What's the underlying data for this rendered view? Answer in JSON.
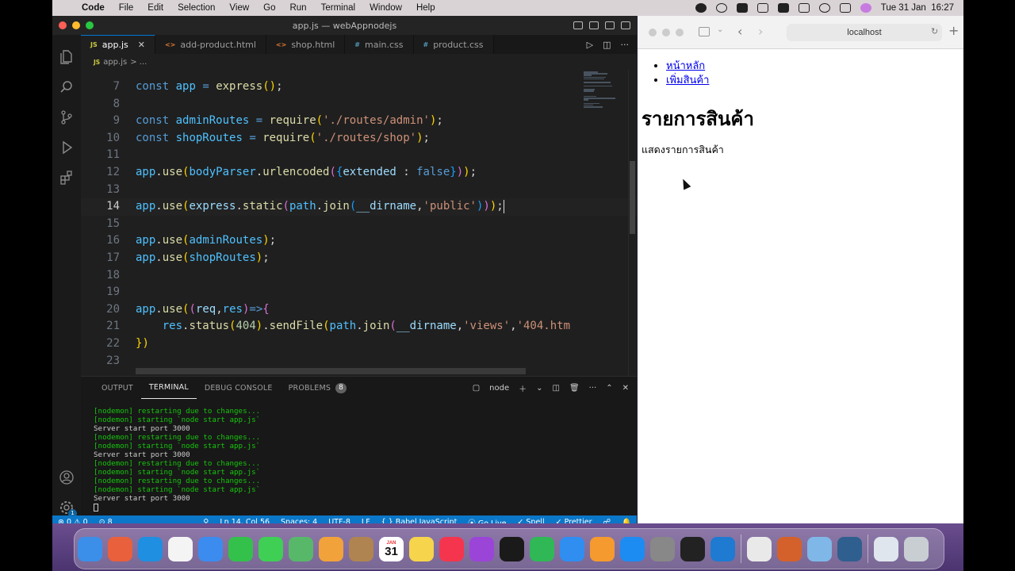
{
  "menubar": {
    "app": "Code",
    "items": [
      "File",
      "Edit",
      "Selection",
      "View",
      "Go",
      "Run",
      "Terminal",
      "Window",
      "Help"
    ],
    "clock": "Tue 31 Jan  16:27"
  },
  "vscode": {
    "title": "app.js — webAppnodejs",
    "tabs": [
      {
        "icon": "JS",
        "label": "app.js",
        "active": true
      },
      {
        "icon": "<>",
        "label": "add-product.html"
      },
      {
        "icon": "<>",
        "label": "shop.html"
      },
      {
        "icon": "#",
        "label": "main.css"
      },
      {
        "icon": "#",
        "label": "product.css"
      }
    ],
    "breadcrumb": {
      "icon": "JS",
      "file": "app.js",
      "rest": "> ..."
    },
    "code_lines": [
      {
        "n": "7",
        "text": "const app = express();"
      },
      {
        "n": "8",
        "text": ""
      },
      {
        "n": "9",
        "text": "const adminRoutes = require('./routes/admin');"
      },
      {
        "n": "10",
        "text": "const shopRoutes = require('./routes/shop');"
      },
      {
        "n": "11",
        "text": ""
      },
      {
        "n": "12",
        "text": "app.use(bodyParser.urlencoded({extended : false}));"
      },
      {
        "n": "13",
        "text": ""
      },
      {
        "n": "14",
        "text": "app.use(express.static(path.join(__dirname,'public')));"
      },
      {
        "n": "15",
        "text": ""
      },
      {
        "n": "16",
        "text": "app.use(adminRoutes);"
      },
      {
        "n": "17",
        "text": "app.use(shopRoutes);"
      },
      {
        "n": "18",
        "text": ""
      },
      {
        "n": "19",
        "text": ""
      },
      {
        "n": "20",
        "text": "app.use((req,res)=>{"
      },
      {
        "n": "21",
        "text": "    res.status(404).sendFile(path.join(__dirname,'views','404.htm"
      },
      {
        "n": "22",
        "text": "})"
      },
      {
        "n": "23",
        "text": ""
      }
    ],
    "panel": {
      "tabs": [
        "OUTPUT",
        "TERMINAL",
        "DEBUG CONSOLE",
        "PROBLEMS"
      ],
      "problems_count": "8",
      "shell": "node",
      "terminal_lines": [
        {
          "text": "[nodemon] restarting due to changes...",
          "green": true
        },
        {
          "text": "[nodemon] starting `node start app.js`",
          "green": true
        },
        {
          "text": "Server start port 3000",
          "green": false
        },
        {
          "text": "[nodemon] restarting due to changes...",
          "green": true
        },
        {
          "text": "[nodemon] starting `node start app.js`",
          "green": true
        },
        {
          "text": "Server start port 3000",
          "green": false
        },
        {
          "text": "[nodemon] restarting due to changes...",
          "green": true
        },
        {
          "text": "[nodemon] starting `node start app.js`",
          "green": true
        },
        {
          "text": "[nodemon] restarting due to changes...",
          "green": true
        },
        {
          "text": "[nodemon] starting `node start app.js`",
          "green": true
        },
        {
          "text": "Server start port 3000",
          "green": false
        }
      ]
    },
    "status": {
      "errors": "⊗ 0 ⚠ 0",
      "ports": "⊙ 8",
      "position": "Ln 14, Col 56",
      "spaces": "Spaces: 4",
      "encoding": "UTF-8",
      "eol": "LF",
      "language": "{ } Babel JavaScript",
      "golive": "Go Live",
      "spell": "✓ Spell",
      "prettier": "✓ Prettier"
    },
    "settings_badge": "1"
  },
  "safari": {
    "url": "localhost",
    "nav_links": [
      "หน้าหลัก",
      "เพิ่มสินค้า"
    ],
    "heading": "รายการสินค้า",
    "paragraph": "แสดงรายการสินค้า"
  },
  "dock": {
    "calendar_month": "JAN",
    "calendar_day": "31",
    "icons": [
      "finder-icon",
      "launchpad-icon",
      "safari-icon",
      "reminders-icon",
      "mail-icon",
      "facetime-icon",
      "messages-icon",
      "maps-icon",
      "photos-icon",
      "contacts-icon",
      "calendar-icon",
      "notes-icon",
      "music-icon",
      "podcasts-icon",
      "tv-icon",
      "numbers-icon",
      "keynote-icon",
      "pages-icon",
      "appstore-icon",
      "settings-icon",
      "terminal-icon",
      "vscode-icon",
      "chrome-icon",
      "toolbox-icon",
      "preview-icon",
      "quicktime-icon",
      "downloads-icon",
      "trash-icon"
    ]
  },
  "colors": {
    "accent": "#0078d4",
    "statusbar": "#0b77c8",
    "terminal_green": "#16c60c"
  }
}
